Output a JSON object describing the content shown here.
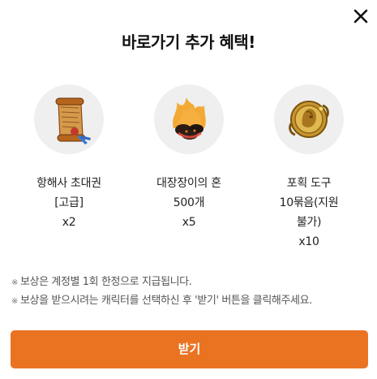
{
  "modal": {
    "title": "바로가기 추가 혜택!",
    "close_icon": "close-icon"
  },
  "rewards": [
    {
      "icon": "voyage-invitation-scroll-icon",
      "lines": [
        "항해사 초대권",
        "[고급]",
        "x2"
      ]
    },
    {
      "icon": "blacksmith-soul-coal-icon",
      "lines": [
        "대장장이의 혼",
        "500개",
        "x5"
      ]
    },
    {
      "icon": "capture-tool-medallion-icon",
      "lines": [
        "포획 도구",
        "10묶음(지원",
        "불가)",
        "x10"
      ]
    }
  ],
  "notes": {
    "mark": "※",
    "items": [
      "보상은 계정별 1회 한정으로 지급됩니다.",
      "보상을 받으시려는 캐릭터를 선택하신 후 '받기' 버튼을 클릭해주세요."
    ]
  },
  "actions": {
    "receive_label": "받기"
  },
  "colors": {
    "accent": "#ea7322",
    "icon_bg": "#efefef",
    "text": "#222222",
    "note_text": "#555555"
  }
}
